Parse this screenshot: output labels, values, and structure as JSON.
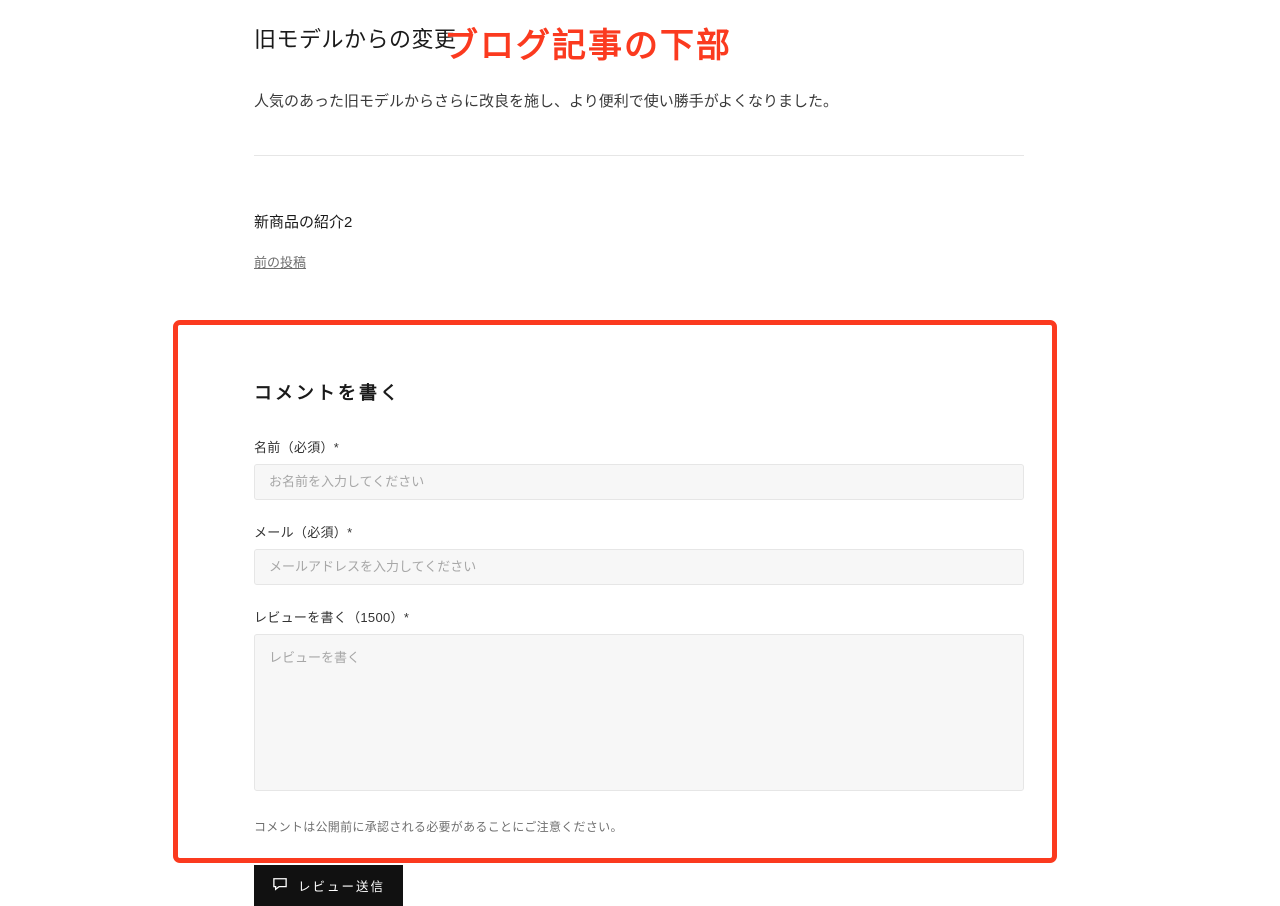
{
  "annotation": "ブログ記事の下部",
  "article": {
    "title": "旧モデルからの変更",
    "body": "人気のあった旧モデルからさらに改良を施し、より便利で使い勝手がよくなりました。"
  },
  "nav": {
    "prev_title": "新商品の紹介2",
    "prev_label": "前の投稿"
  },
  "comment": {
    "heading": "コメントを書く",
    "name_label": "名前（必須）*",
    "name_placeholder": "お名前を入力してください",
    "email_label": "メール（必須）*",
    "email_placeholder": "メールアドレスを入力してください",
    "review_label": "レビューを書く（1500）*",
    "review_placeholder": "レビューを書く",
    "note": "コメントは公開前に承認される必要があることにご注意ください。",
    "submit_label": "レビュー送信"
  }
}
